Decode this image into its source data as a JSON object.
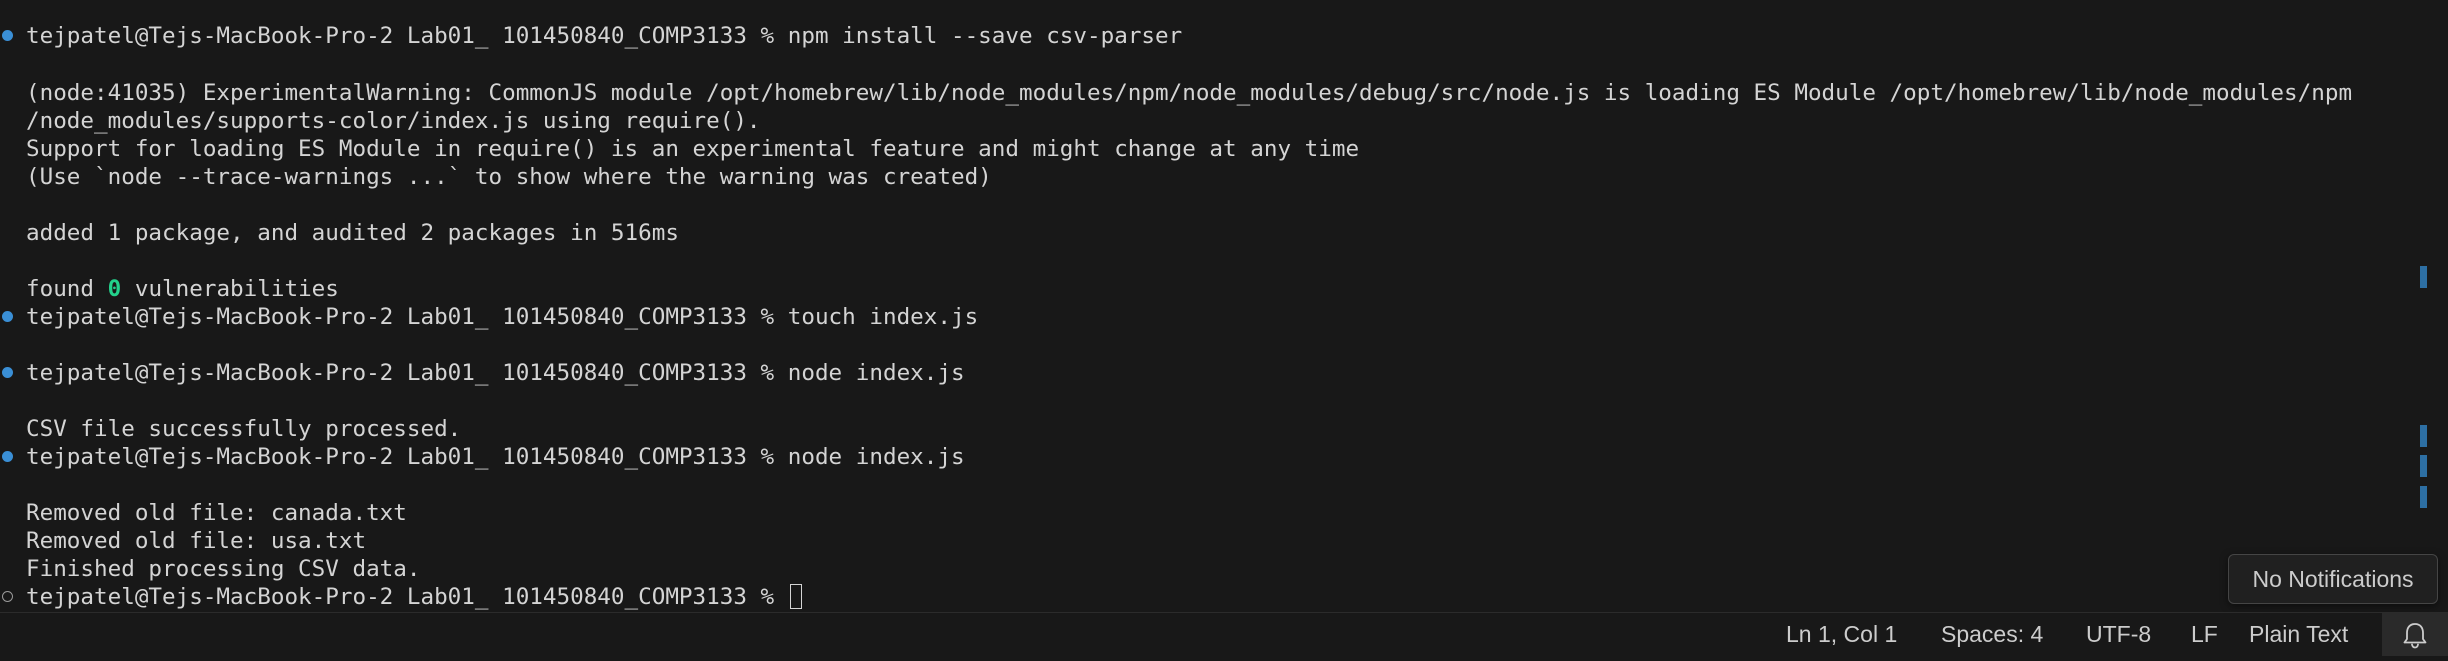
{
  "terminal": {
    "prompt_text": "tejpatel@Tejs-MacBook-Pro-2 Lab01_ 101450840_COMP3133 % ",
    "cmd1": "npm install --save csv-parser",
    "warn1": "(node:41035) ExperimentalWarning: CommonJS module /opt/homebrew/lib/node_modules/npm/node_modules/debug/src/node.js is loading ES Module /opt/homebrew/lib/node_modules/npm",
    "warn2": "/node_modules/supports-color/index.js using require().",
    "warn3": "Support for loading ES Module in require() is an experimental feature and might change at any time",
    "warn4": "(Use `node --trace-warnings ...` to show where the warning was created)",
    "added": "added 1 package, and audited 2 packages in 516ms",
    "found_prefix": "found ",
    "found_count": "0",
    "found_suffix": " vulnerabilities",
    "cmd2": "touch index.js",
    "cmd3": "node index.js",
    "csv_done": "CSV file successfully processed.",
    "cmd4": "node index.js",
    "removed1": "Removed old file: canada.txt",
    "removed2": "Removed old file: usa.txt",
    "finished": "Finished processing CSV data."
  },
  "statusbar": {
    "position": "Ln 1, Col 1",
    "spaces": "Spaces: 4",
    "encoding": "UTF-8",
    "eol": "LF",
    "language": "Plain Text",
    "bell_icon": "bell-icon"
  },
  "notification": {
    "text": "No Notifications"
  },
  "colors": {
    "background": "#181818",
    "text": "#d4d4d4",
    "success_dot": "#3a8fd6",
    "highlight_green": "#23d18b"
  }
}
